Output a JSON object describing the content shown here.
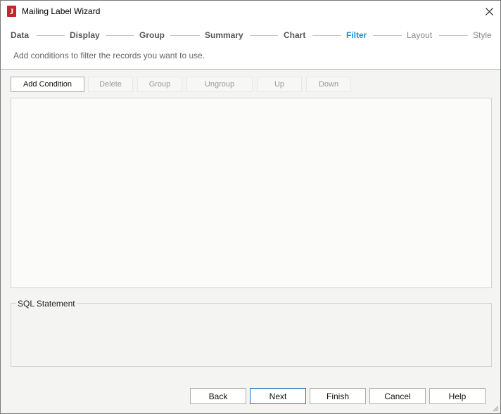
{
  "window": {
    "title": "Mailing Label Wizard"
  },
  "icons": {
    "app": "app-logo-icon",
    "close": "close-icon",
    "grip": "resize-grip-icon"
  },
  "steps": [
    {
      "label": "Data",
      "state": "done"
    },
    {
      "label": "Display",
      "state": "done"
    },
    {
      "label": "Group",
      "state": "done"
    },
    {
      "label": "Summary",
      "state": "done"
    },
    {
      "label": "Chart",
      "state": "done"
    },
    {
      "label": "Filter",
      "state": "active"
    },
    {
      "label": "Layout",
      "state": "future"
    },
    {
      "label": "Style",
      "state": "future"
    }
  ],
  "header": {
    "subtitle": "Add conditions to filter the records you want to use."
  },
  "toolbar": {
    "add_condition": "Add Condition",
    "delete": "Delete",
    "group": "Group",
    "ungroup": "Ungroup",
    "up": "Up",
    "down": "Down"
  },
  "sql": {
    "legend": "SQL Statement"
  },
  "footer": {
    "back": "Back",
    "next": "Next",
    "finish": "Finish",
    "cancel": "Cancel",
    "help": "Help"
  },
  "colors": {
    "active_step": "#1b93d6",
    "app_icon": "#c0282d",
    "default_button_border": "#1b73c4"
  }
}
